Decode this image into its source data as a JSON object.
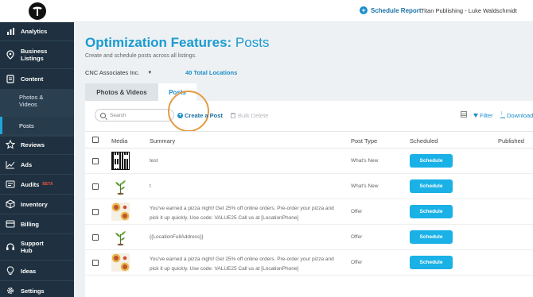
{
  "header": {
    "schedule_report": "Schedule Report",
    "account": "Titan Publishing - Luke Waldschmidt"
  },
  "sidebar": {
    "items": [
      {
        "label": "Analytics",
        "icon": "analytics-icon"
      },
      {
        "label": "Business Listings",
        "icon": "location-pin-icon"
      },
      {
        "label": "Content",
        "icon": "content-icon"
      },
      {
        "label": "Reviews",
        "icon": "star-icon"
      },
      {
        "label": "Ads",
        "icon": "ads-chart-icon"
      },
      {
        "label": "Audits",
        "icon": "audits-icon",
        "badge": "BETA"
      },
      {
        "label": "Inventory",
        "icon": "box-icon"
      },
      {
        "label": "Billing",
        "icon": "billing-icon"
      },
      {
        "label": "Support Hub",
        "icon": "headset-icon"
      },
      {
        "label": "Ideas",
        "icon": "lightbulb-icon"
      },
      {
        "label": "Settings",
        "icon": "gear-icon"
      }
    ],
    "content_sub": {
      "photos_videos": "Photos & Videos",
      "posts": "Posts"
    }
  },
  "main": {
    "title_strong": "Optimization Features:",
    "title_light": "Posts",
    "subtitle": "Create and schedule posts across all listings.",
    "account_select": "CNC Associates Inc.",
    "total_locations": "40 Total Locations",
    "tabs": [
      {
        "label": "Photos & Videos",
        "active": false
      },
      {
        "label": "Posts",
        "active": true
      }
    ]
  },
  "toolbar": {
    "search_placeholder": "Search",
    "create_post": "Create a Post",
    "bulk_delete": "Bulk Delete",
    "filter": "Filter",
    "download": "Download"
  },
  "table": {
    "columns": [
      "Media",
      "Summary",
      "Post Type",
      "Scheduled",
      "Published"
    ],
    "rows": [
      {
        "media": "qr-code-image",
        "summary": "test",
        "post_type": "What's New",
        "action": "Schedule"
      },
      {
        "media": "plant-image",
        "summary": "t",
        "post_type": "What's New",
        "action": "Schedule"
      },
      {
        "media": "pizza-image",
        "summary": "You've earned a pizza night! Get 25% off online orders. Pre-order your pizza and pick it up quickly. Use code: VALUE25 Call us at [LocationPhone]",
        "post_type": "Offer",
        "action": "Schedule"
      },
      {
        "media": "plant-image",
        "summary": "{{LocationFullAddress}}",
        "post_type": "Offer",
        "action": "Schedule"
      },
      {
        "media": "pizza-image",
        "summary": "You've earned a pizza night! Get 25% off online orders. Pre-order your pizza and pick it up quickly. Use code: VALUE25 Call us at [LocationPhone]",
        "post_type": "Offer",
        "action": "Schedule"
      }
    ]
  },
  "colors": {
    "sidebar_bg": "#1f3140",
    "accent": "#1a9bd1",
    "button": "#1ab1e6",
    "highlight_ring": "#e59a45",
    "beta_badge": "#e8523f"
  }
}
